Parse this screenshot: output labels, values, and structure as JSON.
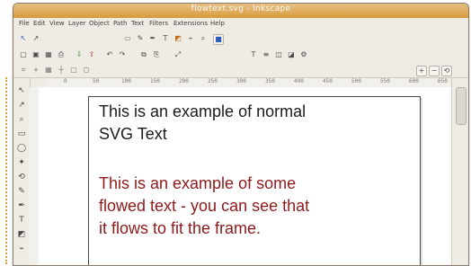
{
  "window": {
    "title": "flowtext.svg - Inkscape"
  },
  "menu": [
    "File",
    "Edit",
    "View",
    "Layer",
    "Object",
    "Path",
    "Text",
    "Filters",
    "Extensions",
    "Help"
  ],
  "toolbars": {
    "row1": [
      {
        "name": "selector-icon",
        "glyph": "↖"
      },
      {
        "name": "node-icon",
        "glyph": "↗"
      },
      {
        "name": "rect-icon",
        "glyph": "▭"
      },
      {
        "name": "pen-icon",
        "glyph": "✎"
      },
      {
        "name": "calligraphy-icon",
        "glyph": "✒"
      },
      {
        "name": "text-icon",
        "glyph": "T"
      },
      {
        "name": "gradient-icon",
        "glyph": "◩"
      },
      {
        "name": "dropper-icon",
        "glyph": "⌁"
      },
      {
        "name": "zoom-icon",
        "glyph": "⌕"
      },
      {
        "name": "color-swatch-icon",
        "glyph": "■"
      }
    ],
    "row2": [
      {
        "name": "new-doc-icon",
        "glyph": "▢"
      },
      {
        "name": "open-icon",
        "glyph": "▣"
      },
      {
        "name": "save-icon",
        "glyph": "▦"
      },
      {
        "name": "print-icon",
        "glyph": "⎙"
      },
      {
        "name": "import-icon",
        "glyph": "⇩"
      },
      {
        "name": "export-icon",
        "glyph": "⇧"
      },
      {
        "name": "undo-icon",
        "glyph": "↶"
      },
      {
        "name": "redo-icon",
        "glyph": "↷"
      },
      {
        "name": "copy-icon",
        "glyph": "⧉"
      },
      {
        "name": "paste-icon",
        "glyph": "⎘"
      },
      {
        "name": "zoom-fit-icon",
        "glyph": "⤢"
      },
      {
        "name": "text-tool-icon",
        "glyph": "T"
      },
      {
        "name": "align-icon",
        "glyph": "≡"
      },
      {
        "name": "group-icon",
        "glyph": "◫"
      },
      {
        "name": "ungroup-icon",
        "glyph": "◪"
      },
      {
        "name": "preferences-icon",
        "glyph": "⚙"
      }
    ],
    "row3": [
      {
        "name": "snap-icon",
        "glyph": "⌗"
      },
      {
        "name": "snap-nodes-icon",
        "glyph": "⋄"
      },
      {
        "name": "snap-grid-icon",
        "glyph": "▦"
      },
      {
        "name": "snap-guides-icon",
        "glyph": "┼"
      },
      {
        "name": "snap-page-icon",
        "glyph": "▢"
      },
      {
        "name": "snap-bbox-icon",
        "glyph": "◻"
      }
    ],
    "right_controls": [
      {
        "name": "zoom-in-icon",
        "glyph": "+"
      },
      {
        "name": "zoom-out-icon",
        "glyph": "−"
      },
      {
        "name": "transform-icon",
        "glyph": "⟲"
      }
    ]
  },
  "ruler": {
    "ticks": [
      "0",
      "50",
      "100",
      "150",
      "200",
      "250",
      "300",
      "350",
      "400",
      "450",
      "500",
      "550",
      "600",
      "650"
    ]
  },
  "canvas": {
    "normal_text": "This is an example of normal\nSVG Text",
    "flowed_text": "This is an example of some\nflowed text - you can see that\nit flows to fit the frame."
  }
}
